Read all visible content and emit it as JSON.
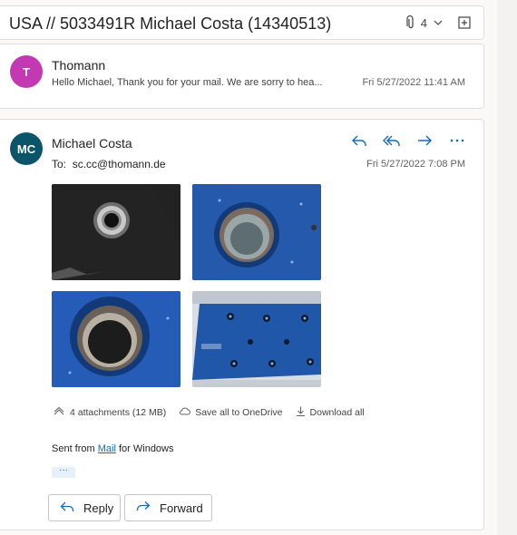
{
  "subject": {
    "title": "USA // 5033491R Michael Costa (14340513)",
    "attachment_count": "4"
  },
  "message_collapsed": {
    "avatar_initials": "T",
    "avatar_color": "#c239b3",
    "sender": "Thomann",
    "preview": "Hello Michael, Thank you for your mail. We are sorry to hea...",
    "date": "Fri 5/27/2022 11:41 AM"
  },
  "message_open": {
    "avatar_initials": "MC",
    "avatar_color": "#0b556a",
    "sender": "Michael Costa",
    "to_label": "To:",
    "to_address": "sc.cc@thomann.de",
    "date": "Fri 5/27/2022 7:08 PM",
    "attachments_label": "4 attachments (12 MB)",
    "save_all_label": "Save all to OneDrive",
    "download_all_label": "Download all",
    "body_prefix": "Sent from ",
    "body_link": "Mail",
    "body_suffix": " for Windows",
    "ellipsis": "···",
    "reply_label": "Reply",
    "forward_label": "Forward"
  },
  "colors": {
    "accent": "#0f6cbd"
  },
  "icons": [
    "paperclip-icon",
    "chevron-down-icon",
    "popout-icon",
    "reply-icon",
    "reply-all-icon",
    "forward-icon",
    "more-icon",
    "attachments-icon",
    "cloud-icon",
    "download-icon"
  ]
}
